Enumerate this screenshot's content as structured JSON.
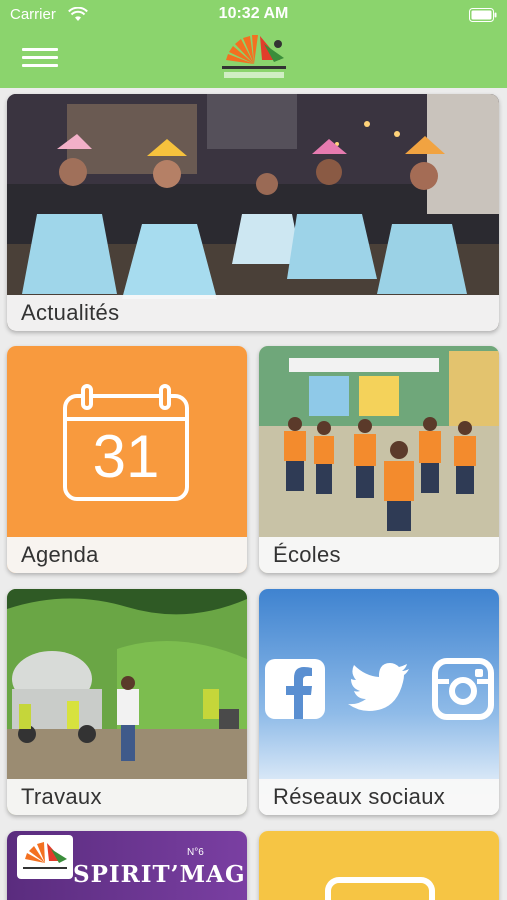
{
  "status_bar": {
    "carrier": "Carrier",
    "time": "10:32 AM"
  },
  "header": {
    "menu_icon": "hamburger-menu-icon",
    "logo_icon": "city-logo-icon"
  },
  "tiles": [
    {
      "id": "actualites",
      "label": "Actualités"
    },
    {
      "id": "agenda",
      "label": "Agenda",
      "calendar_day": "31"
    },
    {
      "id": "ecoles",
      "label": "Écoles"
    },
    {
      "id": "travaux",
      "label": "Travaux"
    },
    {
      "id": "reseaux",
      "label": "Réseaux sociaux",
      "icons": [
        "facebook-icon",
        "twitter-icon",
        "instagram-icon"
      ]
    },
    {
      "id": "mag",
      "title": "SPIRIT’MAG",
      "issue": "N°6"
    },
    {
      "id": "extra"
    }
  ],
  "colors": {
    "header_green": "#8bd46d",
    "agenda_orange": "#f89a3e",
    "social_blue": "#3f83d0",
    "mag_purple": "#5a2c7e",
    "extra_yellow": "#f6c544"
  }
}
